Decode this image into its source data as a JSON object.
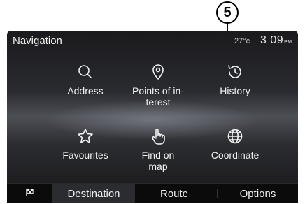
{
  "callout": {
    "number": "5"
  },
  "status": {
    "title": "Navigation",
    "temperature": "27°c",
    "time": "3 09",
    "ampm": "PM"
  },
  "tiles": [
    {
      "label": "Address",
      "icon": "search-icon"
    },
    {
      "label": "Points of in-\nterest",
      "icon": "map-pin-icon"
    },
    {
      "label": "History",
      "icon": "history-icon"
    },
    {
      "label": "Favourites",
      "icon": "star-icon"
    },
    {
      "label": "Find on\nmap",
      "icon": "hand-pointer-icon"
    },
    {
      "label": "Coordinate",
      "icon": "globe-icon"
    }
  ],
  "tabs": {
    "flag": "flag-icon",
    "destination": "Destination",
    "route": "Route",
    "options": "Options"
  },
  "colors": {
    "screen_bg": "#111111",
    "text": "#f2f2f2",
    "active_tab": "#2b2c30"
  }
}
